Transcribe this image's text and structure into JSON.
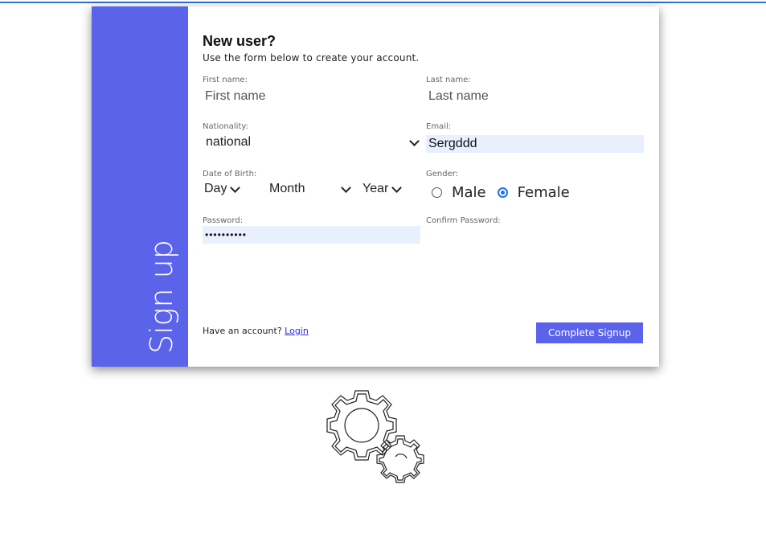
{
  "side": {
    "title": "Sign up"
  },
  "form": {
    "title": "New user?",
    "subtitle": "Use the form below to create your account.",
    "first_name": {
      "label": "First name:",
      "placeholder": "First name"
    },
    "last_name": {
      "label": "Last name:",
      "placeholder": "Last name"
    },
    "nationality": {
      "label": "Nationality:",
      "value": "national"
    },
    "email": {
      "label": "Email:",
      "value": "Sergddd"
    },
    "dob": {
      "label": "Date of Birth:",
      "day": "Day",
      "month": "Month",
      "year": "Year"
    },
    "gender": {
      "label": "Gender:",
      "options": [
        "Male",
        "Female"
      ],
      "selected": "Female"
    },
    "password": {
      "label": "Password:",
      "value": "••••••••••"
    },
    "confirm_password": {
      "label": "Confirm Password:"
    },
    "footer": {
      "have_account": "Have an account? ",
      "login": "Login"
    },
    "submit_label": "Complete Signup"
  },
  "colors": {
    "accent": "#5b63eb",
    "autofill": "#e8f0fe",
    "radio_selected": "#1a73e8"
  },
  "icons": {
    "decor": "gears-icon"
  }
}
